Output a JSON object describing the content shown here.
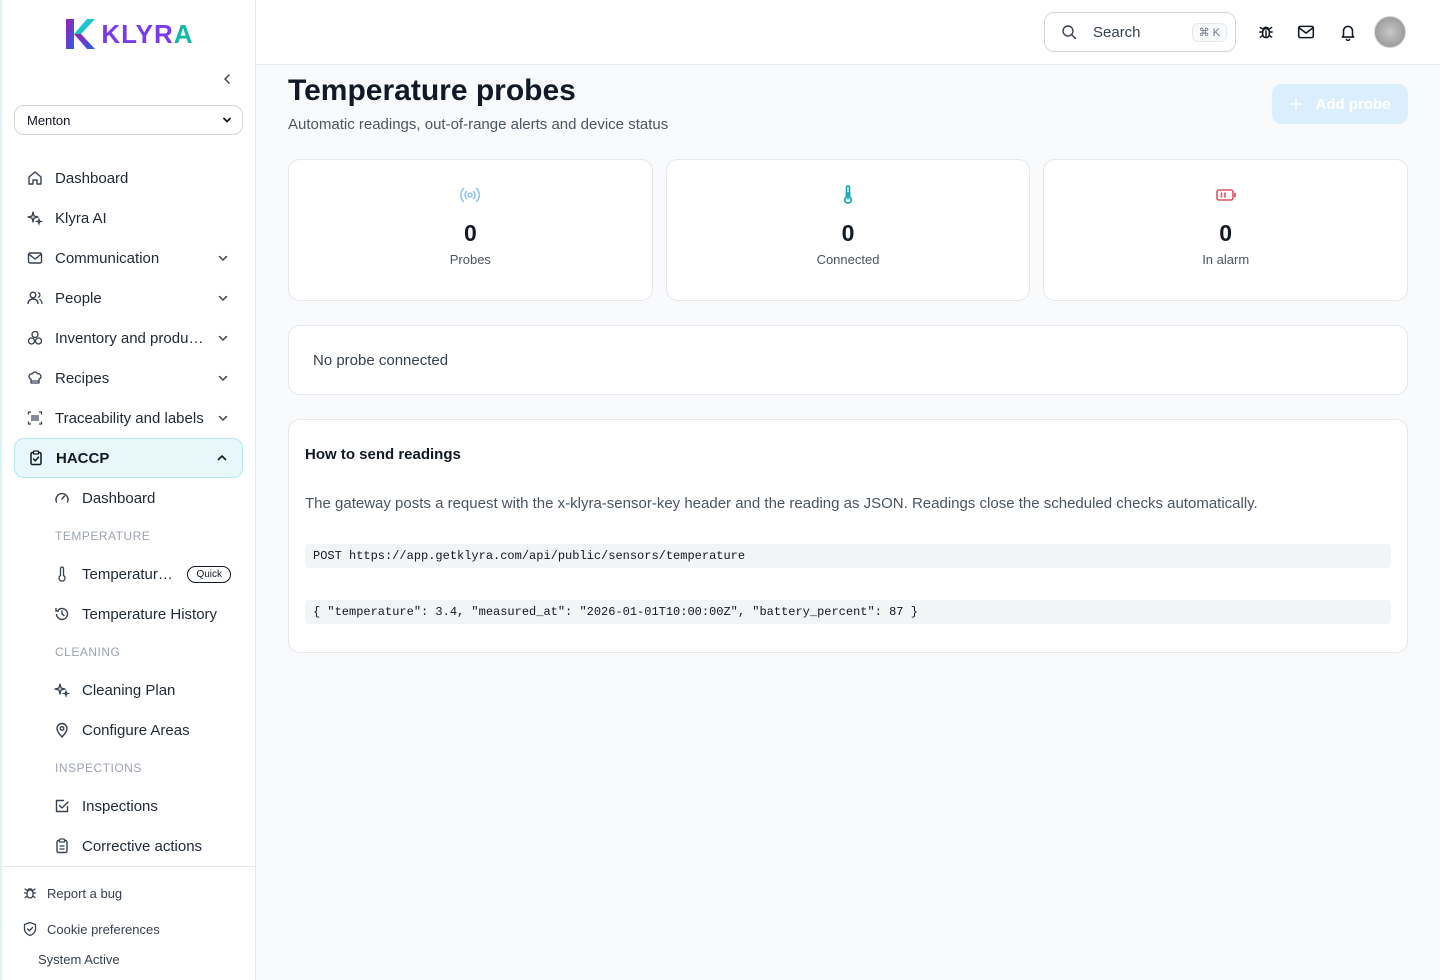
{
  "brand": {
    "name_main": "KLYR",
    "name_end": "A"
  },
  "site_selector": {
    "value": "Menton"
  },
  "nav": {
    "dashboard": "Dashboard",
    "klyra_ai": "Klyra AI",
    "communication": "Communication",
    "people": "People",
    "inventory": "Inventory and production",
    "recipes": "Recipes",
    "traceability": "Traceability and labels",
    "haccp": "HACCP",
    "haccp_sub": {
      "dashboard": "Dashboard",
      "temperature_section": "TEMPERATURE",
      "temperature_probes": "Temperature probes",
      "quick_badge": "Quick",
      "temperature_history": "Temperature History",
      "cleaning_section": "CLEANING",
      "cleaning_plan": "Cleaning Plan",
      "configure_areas": "Configure Areas",
      "inspections_section": "INSPECTIONS",
      "inspections": "Inspections",
      "corrective_actions": "Corrective actions"
    }
  },
  "footer": {
    "report_bug": "Report a bug",
    "cookie_prefs": "Cookie preferences",
    "system_status": "System Active"
  },
  "topbar": {
    "search_placeholder": "Search",
    "search_shortcut": "⌘ K"
  },
  "page": {
    "title": "Temperature probes",
    "subtitle": "Automatic readings, out-of-range alerts and device status",
    "add_button": "Add probe"
  },
  "stats": [
    {
      "value": "0",
      "label": "Probes",
      "icon": "signal-icon",
      "color": "#93c5fd"
    },
    {
      "value": "0",
      "label": "Connected",
      "icon": "thermometer-icon",
      "color": "#0ea5b7"
    },
    {
      "value": "0",
      "label": "In alarm",
      "icon": "battery-warning-icon",
      "color": "#e05263"
    }
  ],
  "empty_state": "No probe connected",
  "howto": {
    "title": "How to send readings",
    "description": "The gateway posts a request with the x-klyra-sensor-key header and the reading as JSON. Readings close the scheduled checks automatically.",
    "endpoint": "POST https://app.getklyra.com/api/public/sensors/temperature",
    "payload": "{ \"temperature\": 3.4, \"measured_at\": \"2026-01-01T10:00:00Z\", \"battery_percent\": 87 }"
  },
  "colors": {
    "accent": "#14b8a6",
    "brand_purple": "#7c3aed",
    "active_bg": "#e8f8fa",
    "primary_disabled": "#dbeefd"
  }
}
